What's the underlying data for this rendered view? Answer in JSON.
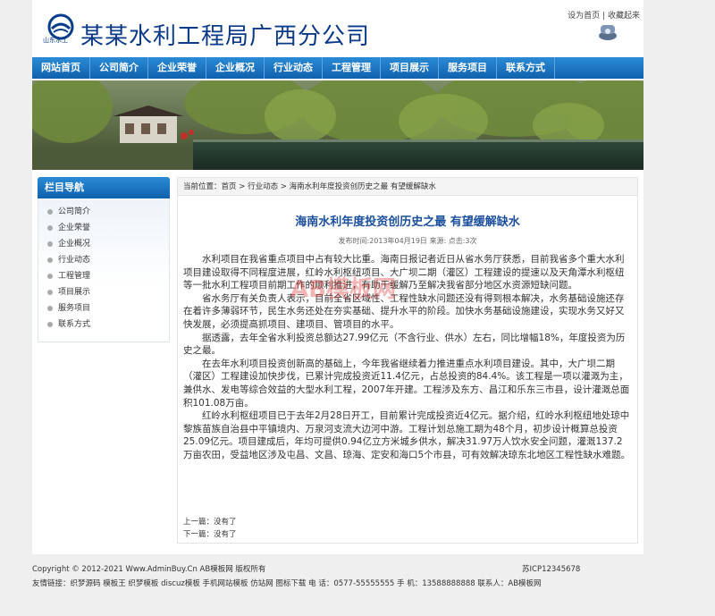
{
  "header": {
    "logo_text": "山东水工",
    "site_title": "某某水利工程局广西分公司",
    "set_home": "设为首页",
    "bookmark": "收藏起来",
    "separator": "|"
  },
  "nav": {
    "items": [
      "网站首页",
      "公司简介",
      "企业荣誉",
      "企业概况",
      "行业动态",
      "工程管理",
      "项目展示",
      "服务项目",
      "联系方式"
    ]
  },
  "sidebar": {
    "title": "栏目导航",
    "items": [
      "公司简介",
      "企业荣誉",
      "企业概况",
      "行业动态",
      "工程管理",
      "项目展示",
      "服务项目",
      "联系方式"
    ]
  },
  "breadcrumb": {
    "prefix": "当前位置：",
    "home": "首页",
    "sep1": " > ",
    "category": "行业动态",
    "sep2": " > ",
    "current": "海南水利年度投资创历史之最 有望缓解缺水"
  },
  "article": {
    "title": "海南水利年度投资创历史之最 有望缓解缺水",
    "meta": "发布时间:2013年04月19日 来源:  点击:3次",
    "paragraphs": [
      "水利项目在我省重点项目中占有较大比重。海南日报记者近日从省水务厅获悉，目前我省多个重大水利项目建设取得不同程度进展，红岭水利枢纽项目、大广坝二期（灌区）工程建设的提速以及天角潭水利枢纽等一批水利工程项目前期工作的顺利推进，有助于缓解乃至解决我省部分地区水资源短缺问题。",
      "省水务厅有关负责人表示，目前全省区域性、工程性缺水问题还没有得到根本解决，水务基础设施还存在着许多薄弱环节，民生水务还处在夯实基础、提升水平的阶段。加快水务基础设施建设，实现水务又好又快发展，必须提高抓项目、建项目、管项目的水平。",
      "据透露，去年全省水利投资总额达27.99亿元（不含行业、供水）左右，同比增幅18%，年度投资为历史之最。",
      "在去年水利项目投资创新高的基础上，今年我省继续着力推进重点水利项目建设。其中，大广坝二期（灌区）工程建设加快步伐，已累计完成投资近11.4亿元，占总投资的84.4%。该工程是一项以灌溉为主，兼供水、发电等综合效益的大型水利工程，2007年开建。工程涉及东方、昌江和乐东三市县，设计灌溉总面积101.08万亩。",
      "红岭水利枢纽项目已于去年2月28日开工，目前累计完成投资近4亿元。据介绍，红岭水利枢纽地处琼中黎族苗族自治县中平镇境内、万泉河支流大边河中游。工程计划总施工期为48个月，初步设计概算总投资25.09亿元。项目建成后，年均可提供0.94亿立方米城乡供水，解决31.97万人饮水安全问题，灌溉137.2万亩农田，受益地区涉及屯昌、文昌、琼海、定安和海口5个市县，可有效解决琼东北地区工程性缺水难题。"
    ],
    "watermark": "AB模板网",
    "prev": "上一篇：没有了",
    "next": "下一篇：没有了"
  },
  "footer": {
    "copyright": "Copyright © 2012-2021 Www.AdminBuy.Cn AB模板网 版权所有",
    "icp": "苏ICP12345678",
    "links": "友情链接：织梦源码 模板王 织梦模板 discuz模板 手机网站模板 仿站网 图标下载 电 话：0577-55555555 手 机：13588888888 联系人：AB模板网"
  },
  "colors": {
    "nav_blue": "#1b7ac6",
    "title_blue": "#1c4f9c",
    "site_title_blue": "#0b3a86"
  }
}
